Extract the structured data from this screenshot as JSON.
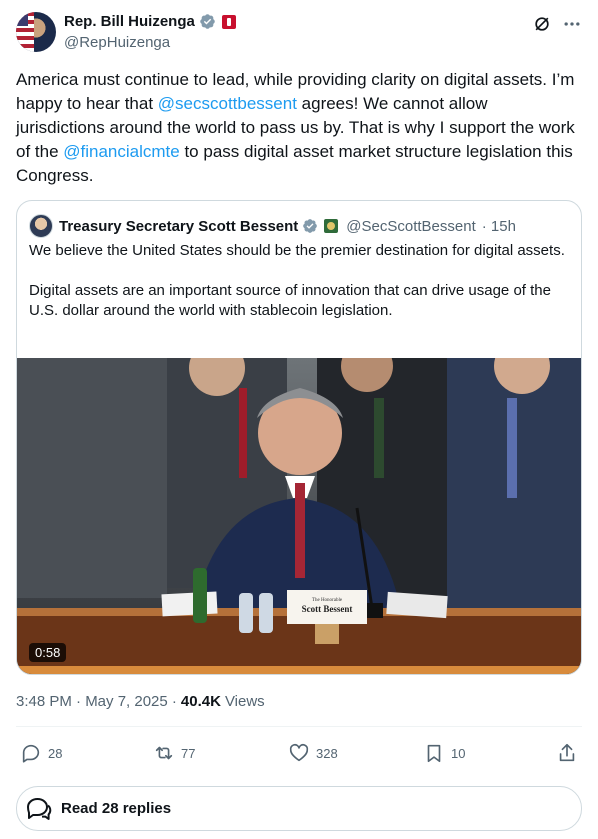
{
  "author": {
    "name": "Rep. Bill Huizenga",
    "handle": "@RepHuizenga"
  },
  "tweet": {
    "part1": "America must continue to lead, while providing clarity on digital assets. I’m happy to hear that ",
    "mention1": "@secscottbessent",
    "part2": " agrees! We cannot allow jurisdictions around the world to pass us by. That is why I support the work of the ",
    "mention2": "@financialcmte",
    "part3": " to pass digital asset market structure legislation this Congress."
  },
  "quote": {
    "name": "Treasury Secretary Scott Bessent",
    "handle": "@SecScottBessent",
    "time": "· 15h",
    "para1": "We believe the United States should be the premier destination for digital assets.",
    "para2": "Digital assets are an important source of innovation that can drive usage of the U.S. dollar around the world with stablecoin legislation.",
    "video_duration": "0:58",
    "nameplate_small": "The Honorable",
    "nameplate_name": "Scott Bessent"
  },
  "meta": {
    "time": "3:48 PM · May 7, 2025 ·",
    "views_count": "40.4K",
    "views_label": "Views"
  },
  "actions": {
    "replies": "28",
    "reposts": "77",
    "likes": "328",
    "bookmarks": "10"
  },
  "read_replies": "Read 28 replies",
  "colors": {
    "link": "#1d9bf0",
    "text": "#0f1419",
    "secondary": "#536471",
    "border": "#cfd9de",
    "verified": "#829aab"
  }
}
